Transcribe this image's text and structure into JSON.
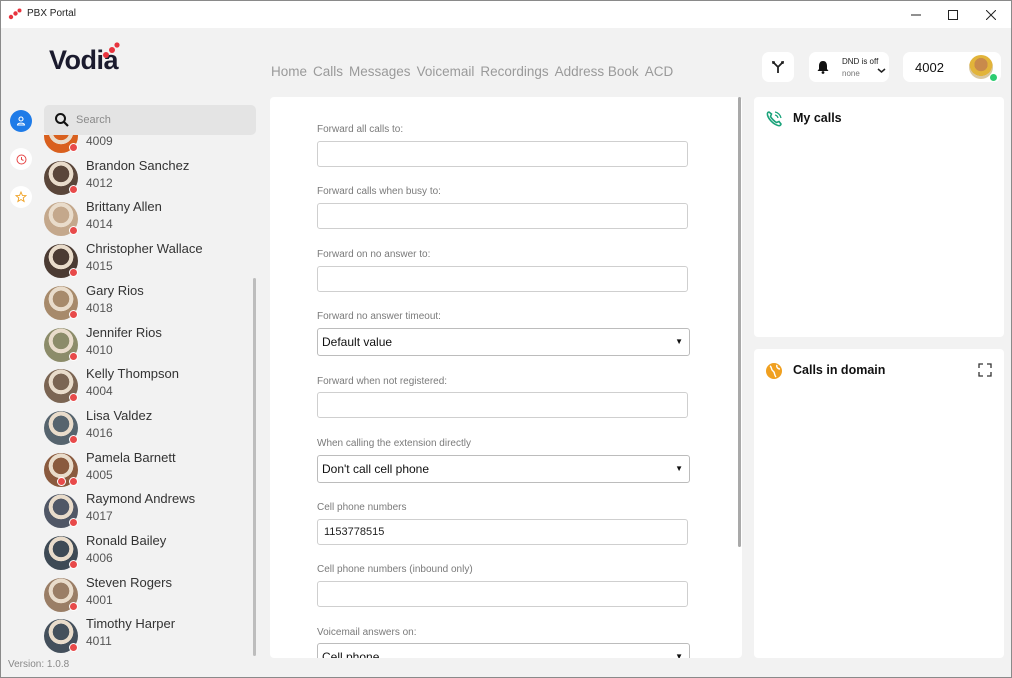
{
  "window": {
    "title": "PBX Portal",
    "controls": {
      "minimize": "—",
      "maximize": "☐",
      "close": "✕"
    }
  },
  "brand": {
    "logo_text": "Vodia",
    "accent": "#e8343e"
  },
  "nav": {
    "items": [
      "Home",
      "Calls",
      "Messages",
      "Voicemail",
      "Recordings",
      "Address Book",
      "ACD"
    ]
  },
  "header": {
    "dnd_status": "DND is off",
    "dnd_value": "none",
    "extension": "4002"
  },
  "rail": {
    "contacts_icon": "person-icon",
    "recent_icon": "clock-icon",
    "favorites_icon": "star-icon",
    "active_color": "#1e7be8"
  },
  "search": {
    "placeholder": "Search"
  },
  "contacts": [
    {
      "name": "",
      "ext": "4009",
      "status": "busy",
      "avatar_color": "#d9601e"
    },
    {
      "name": "Brandon Sanchez",
      "ext": "4012",
      "status": "busy",
      "avatar_color": "#5a463a"
    },
    {
      "name": "Brittany Allen",
      "ext": "4014",
      "status": "busy",
      "avatar_color": "#c4a88c"
    },
    {
      "name": "Christopher Wallace",
      "ext": "4015",
      "status": "busy",
      "avatar_color": "#4b3b33"
    },
    {
      "name": "Gary Rios",
      "ext": "4018",
      "status": "busy",
      "avatar_color": "#a78a6b"
    },
    {
      "name": "Jennifer Rios",
      "ext": "4010",
      "status": "busy",
      "avatar_color": "#8c8c6a"
    },
    {
      "name": "Kelly Thompson",
      "ext": "4004",
      "status": "busy",
      "avatar_color": "#7b6553"
    },
    {
      "name": "Lisa Valdez",
      "ext": "4016",
      "status": "busy",
      "avatar_color": "#56646e"
    },
    {
      "name": "Pamela Barnett",
      "ext": "4005",
      "status": "busy",
      "avatar_color": "#8a5a3e",
      "dnd": true
    },
    {
      "name": "Raymond Andrews",
      "ext": "4017",
      "status": "busy",
      "avatar_color": "#505766"
    },
    {
      "name": "Ronald Bailey",
      "ext": "4006",
      "status": "busy",
      "avatar_color": "#3e4a55"
    },
    {
      "name": "Steven Rogers",
      "ext": "4001",
      "status": "busy",
      "avatar_color": "#9a7e66"
    },
    {
      "name": "Timothy Harper",
      "ext": "4011",
      "status": "busy",
      "avatar_color": "#44505c"
    }
  ],
  "version": "Version: 1.0.8",
  "form": {
    "forward_all": {
      "label": "Forward all calls to:",
      "value": ""
    },
    "forward_busy": {
      "label": "Forward calls when busy to:",
      "value": ""
    },
    "forward_no_answer": {
      "label": "Forward on no answer to:",
      "value": ""
    },
    "no_answer_timeout": {
      "label": "Forward no answer timeout:",
      "value": "Default value"
    },
    "forward_not_registered": {
      "label": "Forward when not registered:",
      "value": ""
    },
    "calling_directly": {
      "label": "When calling the extension directly",
      "value": "Don't call cell phone"
    },
    "cell_numbers": {
      "label": "Cell phone numbers",
      "value": "1153778515"
    },
    "cell_numbers_inbound": {
      "label": "Cell phone numbers (inbound only)",
      "value": ""
    },
    "voicemail_answers": {
      "label": "Voicemail answers on:",
      "value": "Cell phone"
    }
  },
  "panels": {
    "my_calls": {
      "title": "My calls",
      "icon": "phone-icon",
      "icon_color": "#1aa37a"
    },
    "calls_in_domain": {
      "title": "Calls in domain",
      "icon": "globe-icon",
      "icon_color": "#f0a020"
    }
  }
}
